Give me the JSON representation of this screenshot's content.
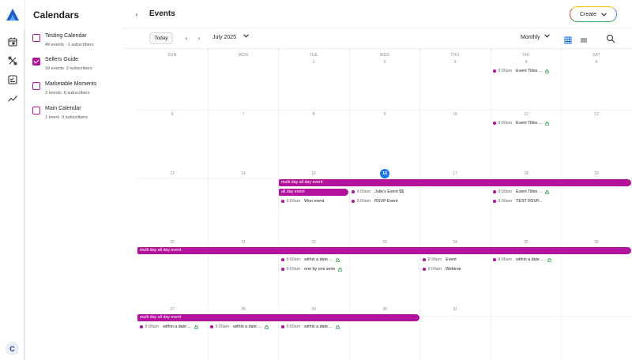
{
  "rail": {
    "icons": [
      "app-logo",
      "calendar-icon",
      "tools-icon",
      "checklist-icon",
      "analytics-icon"
    ],
    "avatar_initial": "C"
  },
  "sidebar": {
    "heading": "Calendars",
    "calendars": [
      {
        "name": "Testing Calendar",
        "events": "49 events",
        "subscribers": "-1 subscribers",
        "checked": false
      },
      {
        "name": "Sellers Guide",
        "events": "18 events",
        "subscribers": "2 subscribers",
        "checked": true
      },
      {
        "name": "Marketable Moments",
        "events": "3 events",
        "subscribers": "0 subscribers",
        "checked": false
      },
      {
        "name": "Main Calendar",
        "events": "1 event",
        "subscribers": "0 subscribers",
        "checked": false
      }
    ]
  },
  "header": {
    "title": "Events",
    "create_label": "Create"
  },
  "toolbar": {
    "today_label": "Today",
    "month_label": "July 2025",
    "view_label": "Monthly"
  },
  "calendar": {
    "weekdays": [
      "SUN",
      "MON",
      "TUE",
      "WED",
      "THU",
      "FRI",
      "SAT"
    ],
    "weeks": [
      [
        "",
        "",
        "1",
        "2",
        "3",
        "4",
        "5"
      ],
      [
        "6",
        "7",
        "8",
        "9",
        "10",
        "11",
        "12"
      ],
      [
        "13",
        "14",
        "15",
        "16",
        "17",
        "18",
        "19"
      ],
      [
        "20",
        "21",
        "22",
        "23",
        "24",
        "25",
        "26"
      ],
      [
        "27",
        "28",
        "29",
        "30",
        "31",
        "",
        ""
      ]
    ],
    "today": "16",
    "accent_color": "#b3129d",
    "today_color": "#1a73e8",
    "multi_day": {
      "w3": "multi day all day event",
      "w3_allday": "all day event",
      "w4": "multi day all day event",
      "w5": "multi day all day event"
    },
    "events": {
      "w1_fri": {
        "time": "9:00am",
        "title": "Event Titles ..."
      },
      "w2_fri": {
        "time": "9:00am",
        "title": "Event Titles ..."
      },
      "w3_tue": {
        "time": "9:00am",
        "title": "Woo event"
      },
      "w3_wed_1": {
        "time": "9:00am",
        "title": "Julie's Event $$"
      },
      "w3_wed_2": {
        "time": "9:00am",
        "title": "RSVP Event"
      },
      "w3_fri_1": {
        "time": "9:00am",
        "title": "Event Titles ..."
      },
      "w3_fri_2": {
        "time": "9:00am",
        "title": "TEST RSVP..."
      },
      "w4_tue_1": {
        "time": "9:00am",
        "title": "within a date ..."
      },
      "w4_tue_2": {
        "time": "9:00am",
        "title": "one by one serie"
      },
      "w4_thu_1": {
        "time": "9:00am",
        "title": "Event"
      },
      "w4_thu_2": {
        "time": "9:00am",
        "title": "Webinar"
      },
      "w4_fri": {
        "time": "9:00am",
        "title": "within a date ..."
      },
      "w5_sun": {
        "time": "9:00am",
        "title": "within a date ..."
      },
      "w5_mon": {
        "time": "9:00am",
        "title": "within a date ..."
      },
      "w5_tue": {
        "time": "9:00am",
        "title": "within a date ..."
      }
    }
  }
}
